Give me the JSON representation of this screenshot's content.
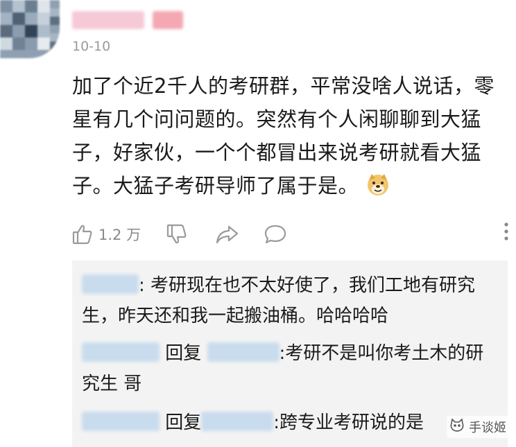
{
  "comment": {
    "timestamp": "10-10",
    "text": "加了个近2千人的考研群，平常没啥人说话，零星有几个问问题的。突然有个人闲聊聊到大猛子，好家伙，一个个都冒出来说考研就看大猛子。大猛子考研导师了属于是。",
    "emoji": "doge-emoji"
  },
  "actions": {
    "like_count": "1.2 万",
    "icons": [
      "thumbs-up-icon",
      "thumbs-down-icon",
      "share-icon",
      "comment-icon",
      "more-icon"
    ]
  },
  "replies": [
    {
      "text": ": 考研现在也不太好使了，我们工地有研究生，昨天还和我一起搬油桶。哈哈哈哈"
    },
    {
      "reply_word": "回复",
      "text": ":考研不是叫你考土木的研究生 哥"
    },
    {
      "reply_word": "回复",
      "text": ":跨专业考研说的是"
    }
  ],
  "watermark": {
    "text": "手谈姬",
    "icon": "cat-face-icon"
  },
  "colors": {
    "text": "#1a1a1a",
    "muted": "#9a9a9a",
    "reply_bg": "#f3f3f3",
    "blur_name": "#c9dced"
  }
}
